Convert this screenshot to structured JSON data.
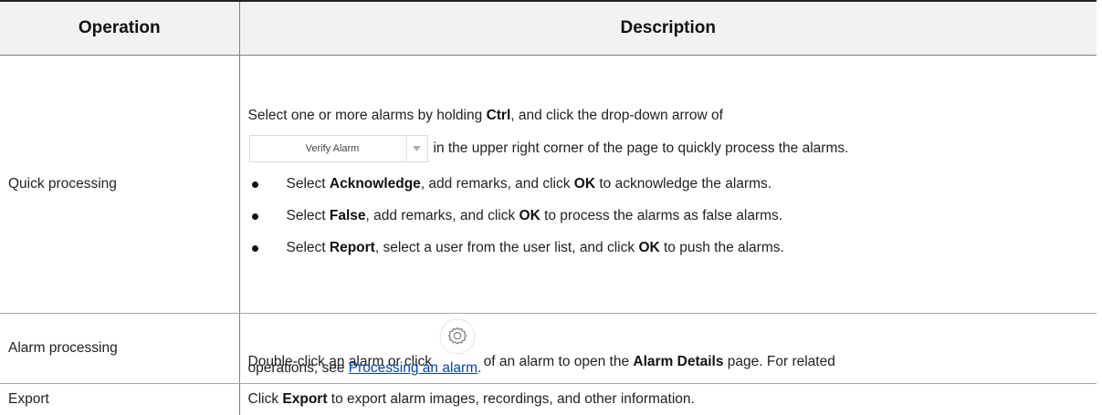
{
  "table": {
    "headers": {
      "operation": "Operation",
      "description": "Description"
    },
    "quick": {
      "operation": "Quick processing",
      "intro_pre": "Select one or more alarms by holding ",
      "intro_key": "Ctrl",
      "intro_post": ", and click the drop-down arrow of",
      "dropdown_value": "Verify Alarm",
      "dropdown_arrow_icon": "caret-down-icon",
      "after_dropdown": " in the upper right corner of the page to quickly process the alarms.",
      "bullets": [
        {
          "pre": "Select ",
          "key": "Acknowledge",
          "mid": ", add remarks, and click ",
          "key2": "OK",
          "post": " to acknowledge the alarms."
        },
        {
          "pre": "Select ",
          "key": "False",
          "mid": ", add remarks, and click ",
          "key2": "OK",
          "post": " to process the alarms as false alarms."
        },
        {
          "pre": "Select ",
          "key": "Report",
          "mid": ", select a user from the user list, and click ",
          "key2": "OK",
          "post": " to push the alarms."
        }
      ]
    },
    "alarm": {
      "operation": "Alarm processing",
      "pre": "Double-click an alarm or click ",
      "icon": "gear-icon",
      "mid": " of an alarm to open the ",
      "key": "Alarm Details",
      "post": " page. For related",
      "line2_pre": "operations, see ",
      "link": "Processing an alarm",
      "line2_post": "."
    },
    "export": {
      "operation": "Export",
      "pre": "Click ",
      "key": "Export",
      "post": " to export alarm images, recordings, and other information."
    }
  }
}
